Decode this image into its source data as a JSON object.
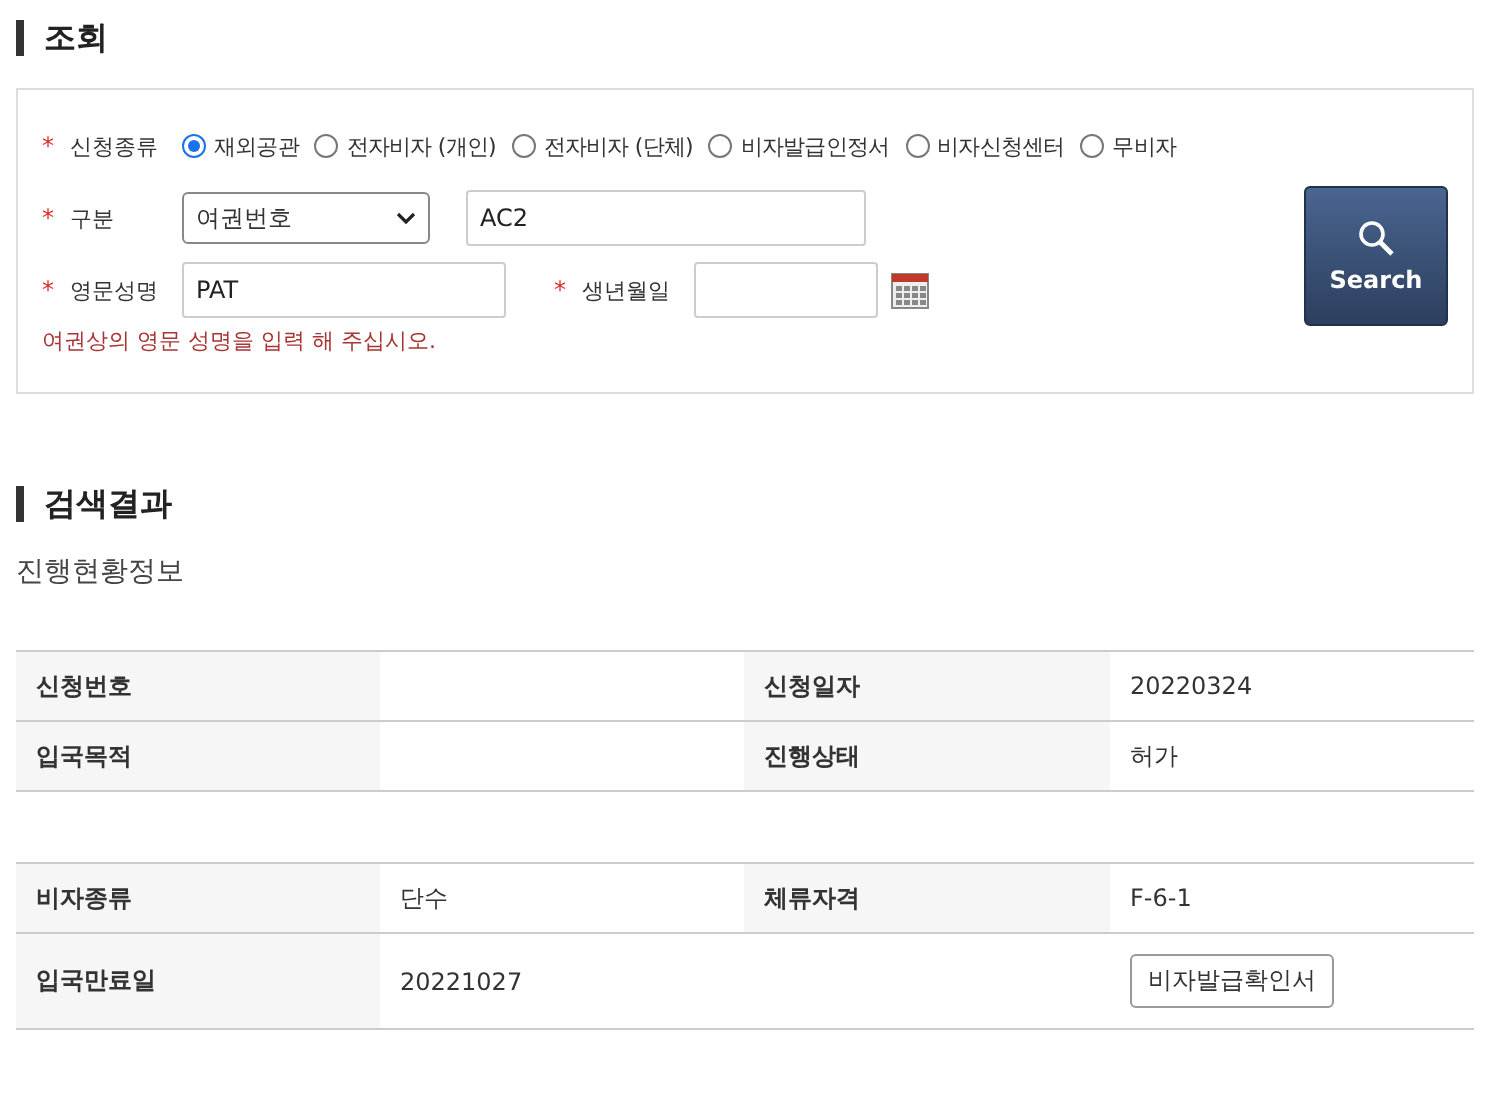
{
  "search_section": {
    "title": "조회",
    "required_mark": "*",
    "application_type": {
      "label": "신청종류",
      "required": true,
      "options": [
        {
          "label": "재외공관",
          "selected": true
        },
        {
          "label": "전자비자 (개인)",
          "selected": false
        },
        {
          "label": "전자비자 (단체)",
          "selected": false
        },
        {
          "label": "비자발급인정서",
          "selected": false
        },
        {
          "label": "비자신청센터",
          "selected": false
        },
        {
          "label": "무비자",
          "selected": false
        }
      ]
    },
    "category": {
      "label": "구분",
      "required": true,
      "select_value": "여권번호",
      "value": "AC2"
    },
    "english_name": {
      "label": "영문성명",
      "required": true,
      "value": "PAT"
    },
    "birth_date": {
      "label": "생년월일",
      "required": true
    },
    "hint": "여권상의 영문 성명을 입력 해 주십시오.",
    "search_button": "Search"
  },
  "results": {
    "title": "검색결과",
    "subtitle": "진행현황정보",
    "tables": [
      {
        "rows": [
          [
            {
              "kind": "label",
              "text": "신청번호"
            },
            {
              "kind": "value",
              "text": ""
            },
            {
              "kind": "label",
              "text": "신청일자"
            },
            {
              "kind": "value",
              "text": "20220324"
            }
          ],
          [
            {
              "kind": "label",
              "text": "입국목적"
            },
            {
              "kind": "value",
              "text": ""
            },
            {
              "kind": "label",
              "text": "진행상태"
            },
            {
              "kind": "value",
              "text": "허가"
            }
          ]
        ]
      },
      {
        "rows": [
          [
            {
              "kind": "label",
              "text": "비자종류"
            },
            {
              "kind": "value",
              "text": "단수"
            },
            {
              "kind": "label",
              "text": "체류자격"
            },
            {
              "kind": "value",
              "text": "F-6-1"
            }
          ],
          [
            {
              "kind": "label",
              "text": "입국만료일"
            },
            {
              "kind": "value",
              "text": "20221027"
            },
            {
              "kind": "value",
              "text": ""
            },
            {
              "kind": "button",
              "text": "비자발급확인서"
            }
          ]
        ]
      }
    ]
  }
}
